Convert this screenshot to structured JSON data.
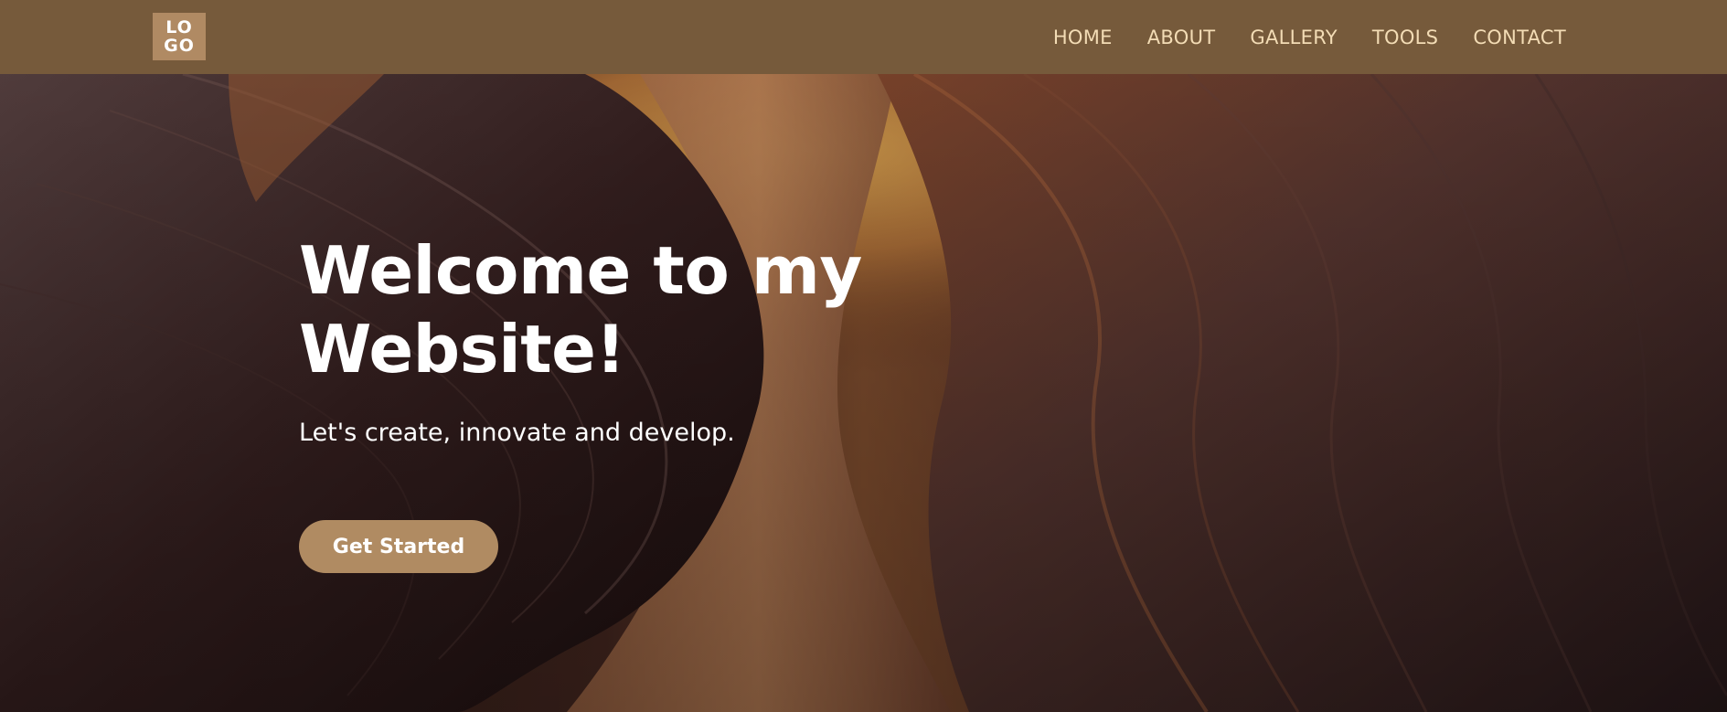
{
  "header": {
    "logo_line1": "LO",
    "logo_line2": "GO",
    "nav": [
      {
        "label": "HOME"
      },
      {
        "label": "ABOUT"
      },
      {
        "label": "GALLERY"
      },
      {
        "label": "TOOLS"
      },
      {
        "label": "CONTACT"
      }
    ]
  },
  "hero": {
    "title_line1": "Welcome to my",
    "title_line2": "Website!",
    "subtitle": "Let's create, innovate and develop.",
    "cta_label": "Get Started",
    "background_image": "canyon-rock-formation"
  },
  "colors": {
    "navbar": "#765a3b",
    "logo_bg": "#b08a63",
    "nav_text": "#f3dcb5",
    "cta_bg": "#b08b62",
    "hero_text": "#ffffff"
  }
}
